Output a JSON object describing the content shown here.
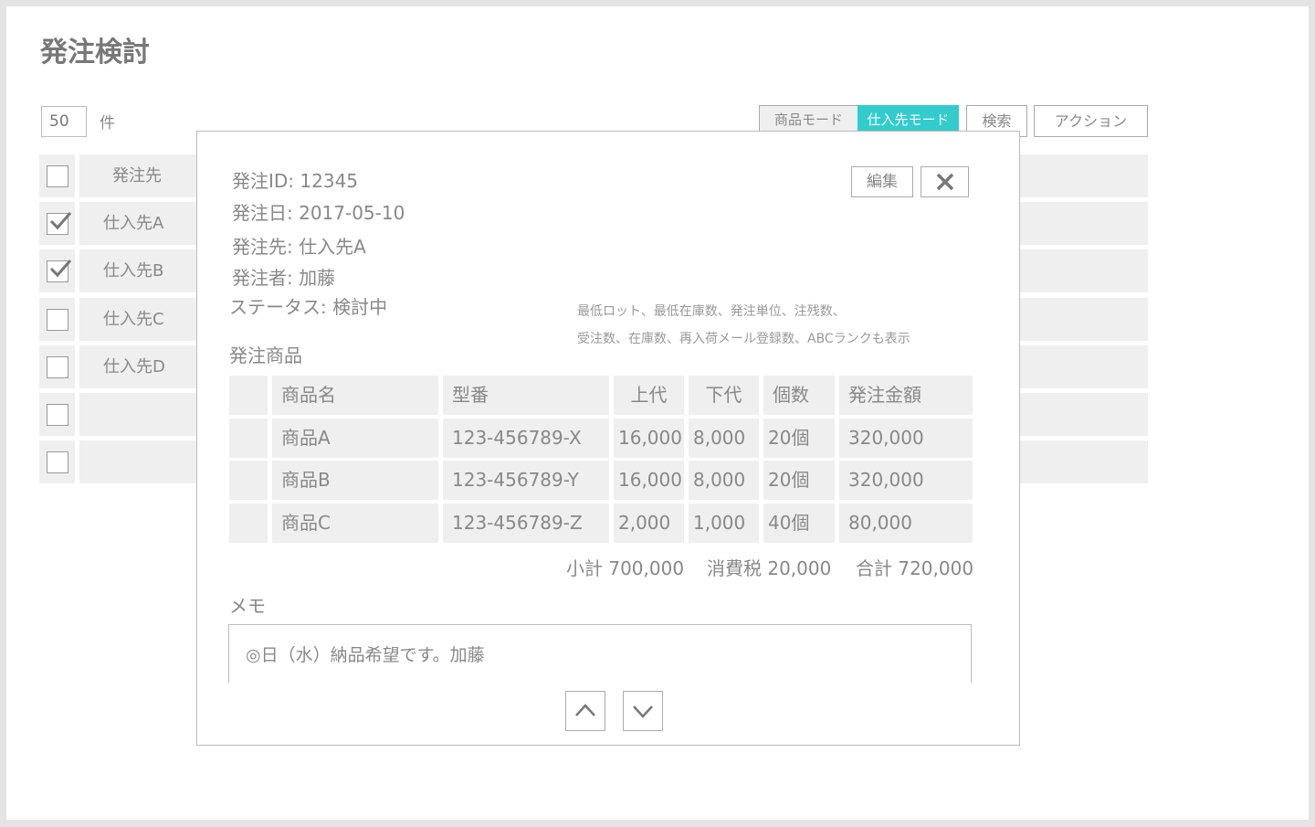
{
  "page": {
    "title": "発注検討",
    "count": "50",
    "count_unit": "件"
  },
  "toolbar": {
    "mode_product": "商品モード",
    "mode_supplier": "仕入先モード",
    "search": "検索",
    "action": "アクション",
    "accent": "#33cccc"
  },
  "list": {
    "header": "発注先",
    "rows": [
      {
        "name": "仕入先A",
        "checked": true
      },
      {
        "name": "仕入先B",
        "checked": true
      },
      {
        "name": "仕入先C",
        "checked": false
      },
      {
        "name": "仕入先D",
        "checked": false
      },
      {
        "name": "",
        "checked": false
      },
      {
        "name": "",
        "checked": false
      }
    ]
  },
  "modal": {
    "order_id": "発注ID: 12345",
    "order_date": "発注日: 2017-05-10",
    "supplier": "発注先: 仕入先A",
    "orderer": "発注者: 加藤",
    "status": "ステータス: 検討中",
    "edit": "編集",
    "close_icon": "close-icon",
    "note_line1": "最低ロット、最低在庫数、発注単位、注残数、",
    "note_line2": "受注数、在庫数、再入荷メール登録数、ABCランクも表示",
    "items_label": "発注商品",
    "columns": [
      "",
      "商品名",
      "型番",
      "上代",
      "下代",
      "個数",
      "発注金額"
    ],
    "rows": [
      [
        "",
        "商品A",
        "123-456789-X",
        "16,000",
        "8,000",
        "20個",
        "320,000"
      ],
      [
        "",
        "商品B",
        "123-456789-Y",
        "16,000",
        "8,000",
        "20個",
        "320,000"
      ],
      [
        "",
        "商品C",
        "123-456789-Z",
        "2,000",
        "1,000",
        "40個",
        "80,000"
      ]
    ],
    "subtotal": "小計 700,000",
    "tax": "消費税 20,000",
    "total": "合計 720,000",
    "memo_label": "メモ",
    "memo": "◎日（水）納品希望です。加藤"
  }
}
